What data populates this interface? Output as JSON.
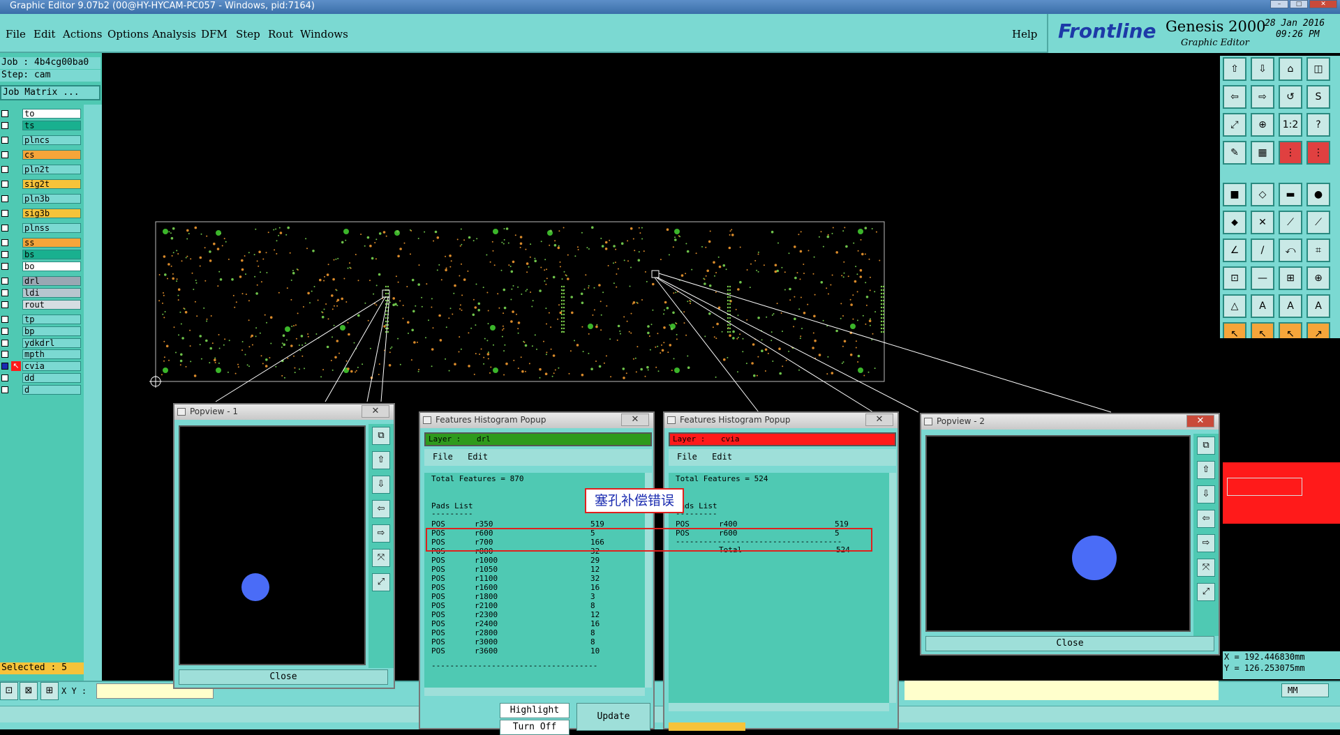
{
  "window": {
    "title": "Graphic Editor 9.07b2 (00@HY-HYCAM-PC057 - Windows, pid:7164)"
  },
  "menu": [
    "File",
    "Edit",
    "Actions",
    "Options",
    "Analysis",
    "DFM",
    "Step",
    "Rout",
    "Windows"
  ],
  "help": "Help",
  "brand": {
    "logo": "Frontline",
    "product": "Genesis 2000",
    "subtitle": "Graphic Editor",
    "date": "28 Jan 2016",
    "time": "09:26 PM"
  },
  "job": {
    "job": "Job : 4b4cg00ba0",
    "step": "Step: cam",
    "matrix_btn": "Job Matrix ..."
  },
  "layers": [
    {
      "name": "to",
      "color": "#ffffff"
    },
    {
      "name": "ts",
      "color": "#19b08f"
    },
    {
      "name": "plncs",
      "color": "#7bd9d2"
    },
    {
      "name": "cs",
      "color": "#f6a53a"
    },
    {
      "name": "pln2t",
      "color": "#7bd9d2"
    },
    {
      "name": "sig2t",
      "color": "#f6c33a"
    },
    {
      "name": "pln3b",
      "color": "#7bd9d2"
    },
    {
      "name": "sig3b",
      "color": "#f6c33a"
    },
    {
      "name": "plnss",
      "color": "#7bd9d2"
    },
    {
      "name": "ss",
      "color": "#f6a53a"
    },
    {
      "name": "bs",
      "color": "#19b08f"
    },
    {
      "name": "bo",
      "color": "#ffffff"
    },
    {
      "name": "drl",
      "color": "#9aa7b3"
    },
    {
      "name": "ldi",
      "color": "#b7c6cf"
    },
    {
      "name": "rout",
      "color": "#d6dde2"
    },
    {
      "name": "tp",
      "color": "#7bd9d2"
    },
    {
      "name": "bp",
      "color": "#7bd9d2"
    },
    {
      "name": "ydkdrl",
      "color": "#7bd9d2"
    },
    {
      "name": "mpth",
      "color": "#7bd9d2"
    },
    {
      "name": "cvia",
      "color": "#7bd9d2"
    },
    {
      "name": "dd",
      "color": "#7bd9d2"
    },
    {
      "name": "d",
      "color": "#7bd9d2"
    }
  ],
  "selected": "Selected : 5",
  "popview1": {
    "title": "Popview - 1",
    "close": "Close"
  },
  "popview2": {
    "title": "Popview - 2",
    "close": "Close"
  },
  "hist1": {
    "title": "Features Histogram Popup",
    "layer_label": "Layer :",
    "layer": "drl",
    "file": "File",
    "edit": "Edit",
    "total": "Total Features = 870",
    "pads": "Pads List",
    "sep": "---------",
    "rows": [
      [
        "POS",
        "r350",
        "519"
      ],
      [
        "POS",
        "r600",
        "5"
      ],
      [
        "POS",
        "r700",
        "166"
      ],
      [
        "POS",
        "r800",
        "32"
      ],
      [
        "POS",
        "r1000",
        "29"
      ],
      [
        "POS",
        "r1050",
        "12"
      ],
      [
        "POS",
        "r1100",
        "32"
      ],
      [
        "POS",
        "r1600",
        "16"
      ],
      [
        "POS",
        "r1800",
        "3"
      ],
      [
        "POS",
        "r2100",
        "8"
      ],
      [
        "POS",
        "r2300",
        "12"
      ],
      [
        "POS",
        "r2400",
        "16"
      ],
      [
        "POS",
        "r2800",
        "8"
      ],
      [
        "POS",
        "r3000",
        "8"
      ],
      [
        "POS",
        "r3600",
        "10"
      ]
    ],
    "btn_highlight": "Highlight",
    "btn_update": "Update",
    "btn_turnoff": "Turn Off"
  },
  "hist2": {
    "title": "Features Histogram Popup",
    "layer_label": "Layer :",
    "layer": "cvia",
    "file": "File",
    "edit": "Edit",
    "total": "Total Features = 524",
    "pads": "Pads List",
    "sep": "---------",
    "rows": [
      [
        "POS",
        "r400",
        "519"
      ],
      [
        "POS",
        "r600",
        "5"
      ]
    ],
    "total_label": "Total",
    "total_value": "524"
  },
  "annotation": "塞孔补偿错误",
  "coords": {
    "x": "X = 192.446830mm",
    "y": "Y = 126.253075mm",
    "unit": "MM"
  },
  "xy_label": "X Y :",
  "colors": {
    "teal": "#7bd9d2",
    "panel": "#4fc9b3",
    "accent_red": "#ff1a1a",
    "accent_orange": "#f6a53a",
    "pad_blue": "#4a6cf7"
  }
}
